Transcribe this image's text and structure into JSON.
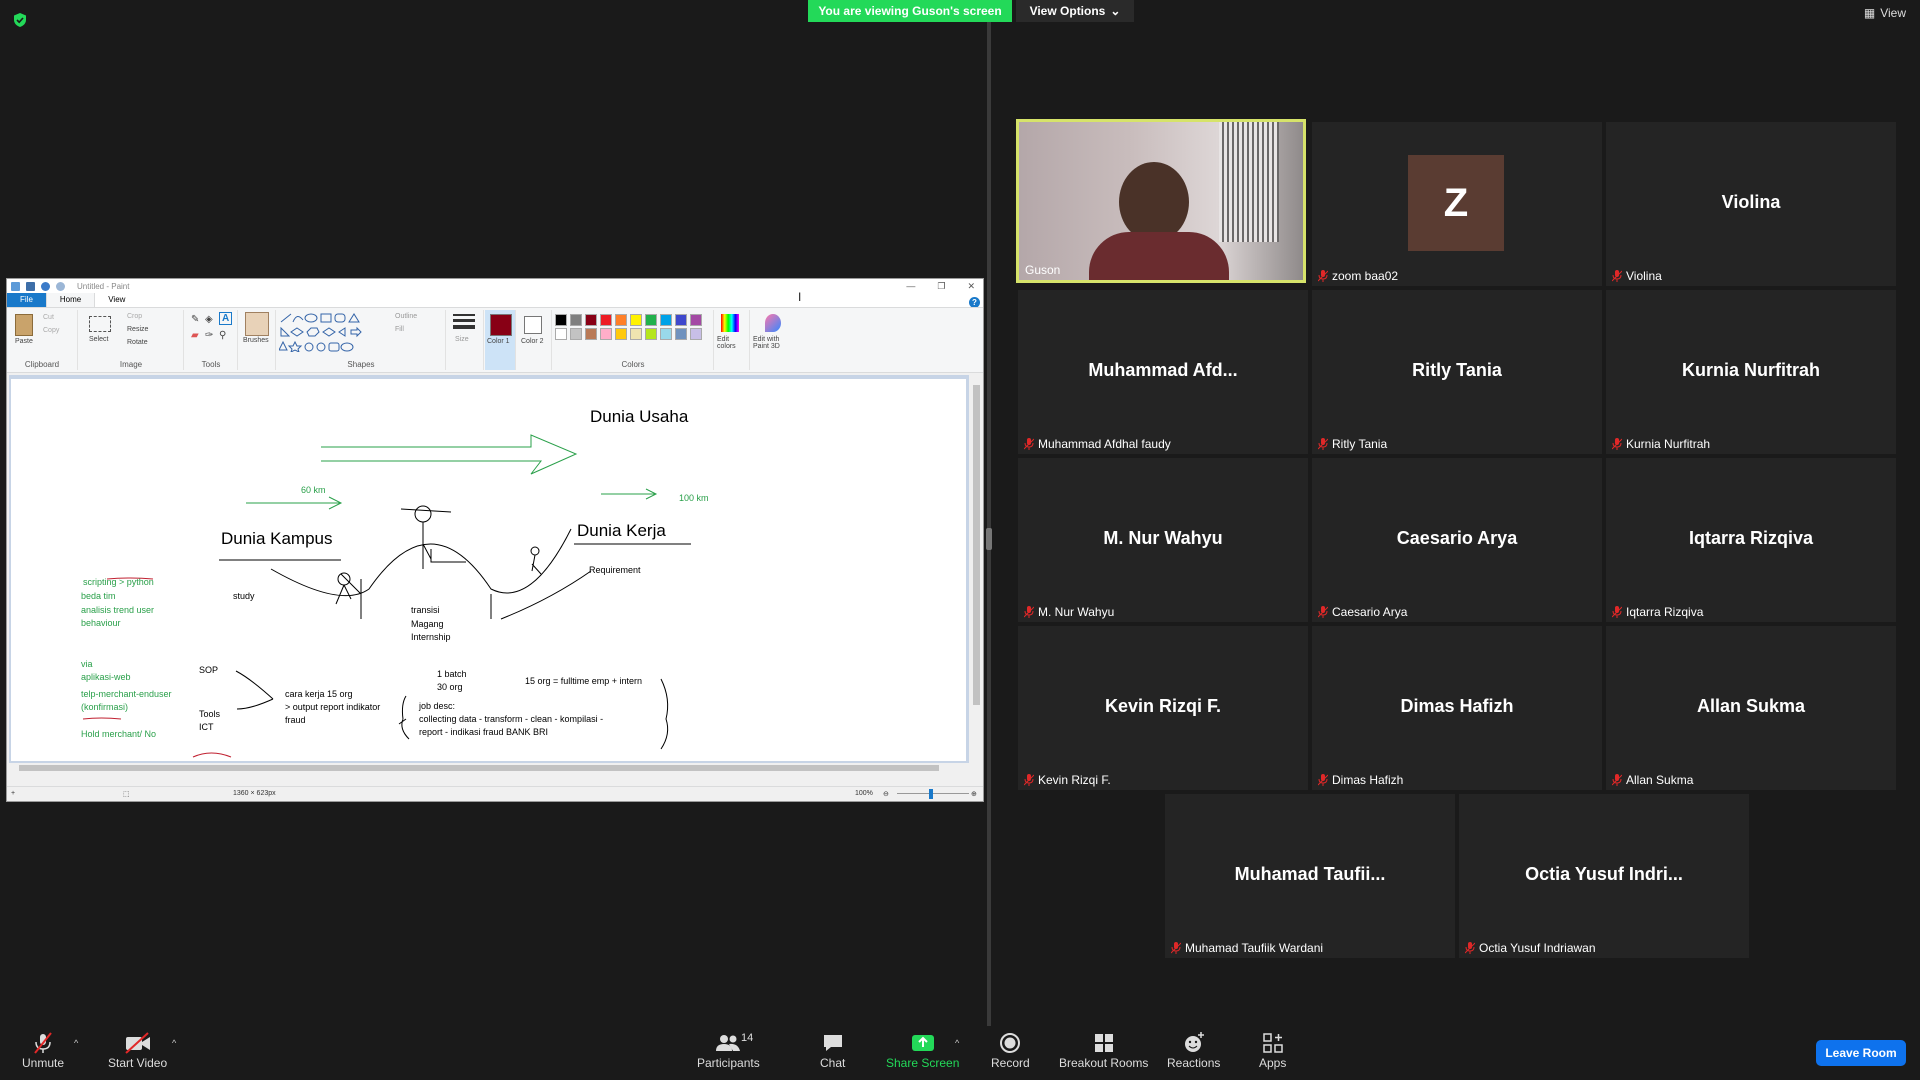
{
  "banner": {
    "viewing": "You are viewing Guson's screen",
    "view_options": "View Options"
  },
  "top_right": {
    "view": "View"
  },
  "paint": {
    "title": "Untitled - Paint",
    "tabs": [
      "File",
      "Home",
      "View"
    ],
    "groups": {
      "clipboard": "Clipboard",
      "image": "Image",
      "tools": "Tools",
      "shapes": "Shapes",
      "colors": "Colors"
    },
    "buttons": {
      "paste": "Paste",
      "cut": "Cut",
      "copy": "Copy",
      "select": "Select",
      "crop": "Crop",
      "resize": "Resize",
      "rotate": "Rotate",
      "brushes": "Brushes",
      "outline": "Outline",
      "fill": "Fill",
      "size": "Size",
      "color1": "Color 1",
      "color2": "Color 2",
      "edit_colors": "Edit colors",
      "edit_paint3d": "Edit with Paint 3D"
    },
    "palette": [
      "#000000",
      "#7f7f7f",
      "#880015",
      "#ed1c24",
      "#ff7f27",
      "#fff200",
      "#22b14c",
      "#00a2e8",
      "#3f48cc",
      "#a349a4",
      "#ffffff",
      "#c3c3c3",
      "#b97a57",
      "#ffaec9",
      "#ffc90e",
      "#efe4b0",
      "#b5e61d",
      "#99d9ea",
      "#7092be",
      "#c8bfe7"
    ],
    "color1_value": "#880015",
    "status": {
      "size": "1360 × 623px",
      "zoom": "100%"
    },
    "drawing": {
      "dunia_usaha": "Dunia Usaha",
      "dunia_kampus": "Dunia Kampus",
      "dunia_kerja": "Dunia Kerja",
      "km60": "60 km",
      "km100": "100 km",
      "requirement": "Requirement",
      "study": "study",
      "transisi": "transisi",
      "magang": "Magang",
      "internship": "Internship",
      "scripting": "scripting > python",
      "beda_tim": "beda tim",
      "analisis": "analisis trend user",
      "behaviour": "behaviour",
      "via": "via",
      "aplikasi": "aplikasi-web",
      "telp": "telp-merchant-enduser",
      "konfirmasi": "(konfirmasi)",
      "hold": "Hold merchant/ No",
      "sop": "SOP",
      "tools": "Tools",
      "ict": "ICT",
      "cara_kerja": "cara kerja 15 org",
      "output": "> output report indikator",
      "fraud": "fraud",
      "batch": "1 batch",
      "org30": "30 org",
      "org15": "15 org = fulltime emp + intern",
      "jobdesc": "job desc:",
      "collecting": "collecting data - transform - clean - kompilasi -",
      "report": "report - indikasi fraud BANK BRI"
    }
  },
  "participants": [
    {
      "name": "Guson",
      "big": "",
      "video": true
    },
    {
      "name": "zoom baa02",
      "big": "Z",
      "avatar": true
    },
    {
      "name": "Violina",
      "big": "Violina"
    },
    {
      "name": "Muhammad Afdhal faudy",
      "big": "Muhammad  Afd..."
    },
    {
      "name": "Ritly Tania",
      "big": "Ritly Tania"
    },
    {
      "name": "Kurnia Nurfitrah",
      "big": "Kurnia Nurfitrah"
    },
    {
      "name": "M. Nur Wahyu",
      "big": "M. Nur Wahyu"
    },
    {
      "name": "Caesario Arya",
      "big": "Caesario Arya"
    },
    {
      "name": "Iqtarra Rizqiva",
      "big": "Iqtarra Rizqiva"
    },
    {
      "name": "Kevin Rizqi F.",
      "big": "Kevin Rizqi F."
    },
    {
      "name": "Dimas Hafizh",
      "big": "Dimas Hafizh"
    },
    {
      "name": "Allan Sukma",
      "big": "Allan Sukma"
    },
    {
      "name": "Muhamad Taufiik Wardani",
      "big": "Muhamad  Taufii..."
    },
    {
      "name": "Octia Yusuf Indriawan",
      "big": "Octia  Yusuf Indri..."
    }
  ],
  "toolbar": {
    "unmute": "Unmute",
    "start_video": "Start Video",
    "participants": "Participants",
    "participants_count": "14",
    "chat": "Chat",
    "share_screen": "Share Screen",
    "record": "Record",
    "breakout": "Breakout Rooms",
    "reactions": "Reactions",
    "apps": "Apps",
    "leave": "Leave Room"
  }
}
